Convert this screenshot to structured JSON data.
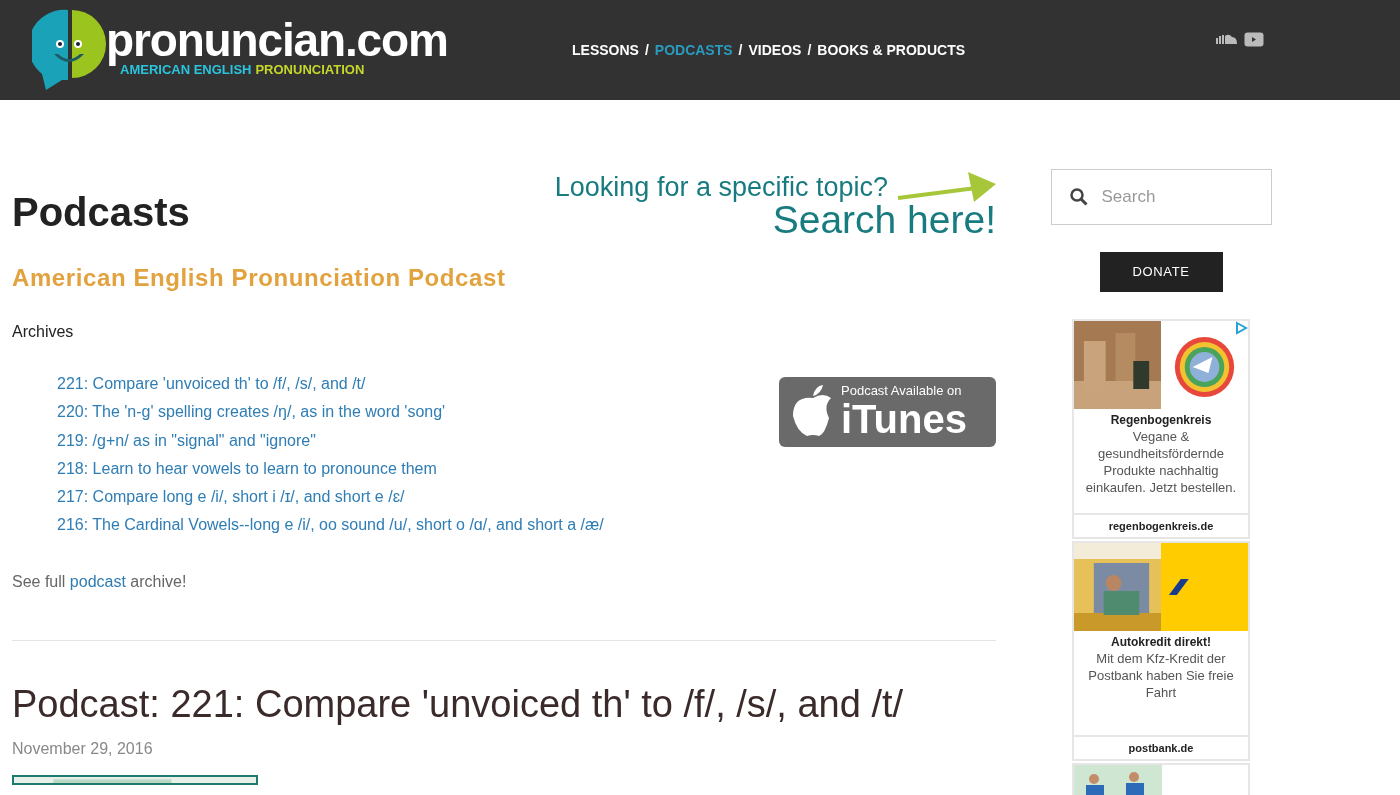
{
  "header": {
    "logo": {
      "name": "pronuncian.com",
      "tagline_1": "AMERICAN ENGLISH",
      "tagline_2": "PRONUNCIATION"
    },
    "nav": [
      {
        "label": "LESSONS",
        "selected": false
      },
      {
        "label": "PODCASTS",
        "selected": true
      },
      {
        "label": "VIDEOS",
        "selected": false
      },
      {
        "label": "BOOKS & PRODUCTS",
        "selected": false
      }
    ],
    "nav_separators": [
      "/",
      "/",
      "/"
    ]
  },
  "page": {
    "title": "Podcasts",
    "search_promo": {
      "line_1": "Looking for a specific topic?",
      "line_2": "Search here!"
    },
    "subtitle": "American English Pronunciation Podcast",
    "archives_label": "Archives",
    "episodes": [
      "221: Compare 'unvoiced th' to /f/, /s/, and /t/",
      "220: The 'n-g' spelling creates /ŋ/, as in the word 'song'",
      "219: /g+n/ as in \"signal\" and \"ignore\"",
      "218: Learn to hear vowels to learn to pronounce them",
      "217: Compare long e /i/, short i /ɪ/, and short e /ɛ/",
      "216: The Cardinal Vowels--long e /i/, oo sound /u/, short o /ɑ/, and short a /æ/"
    ],
    "itunes_badge": {
      "line_1": "Podcast Available on",
      "line_2": "iTunes"
    },
    "archive_note": {
      "prefix": "See full",
      "link": "podcast",
      "suffix": "archive!"
    },
    "post": {
      "title": "Podcast: 221: Compare 'unvoiced th' to /f/, /s/, and /t/",
      "date": "November 29, 2016"
    }
  },
  "sidebar": {
    "search": {
      "placeholder": "Search"
    },
    "donate_button": "DONATE",
    "ads": [
      {
        "kind": "goods",
        "title": "Regenbogenkreis",
        "text": "Vegane & gesundheitsfördernde Produkte nachhaltig einkaufen. Jetzt bestellen.",
        "domain": "regenbogenkreis.de"
      },
      {
        "kind": "bank",
        "title": "Autokredit direkt!",
        "text": "Mit dem Kfz-Kredit der Postbank haben Sie freie Fahrt",
        "domain": "postbank.de"
      },
      {
        "kind": "sport"
      }
    ]
  }
}
